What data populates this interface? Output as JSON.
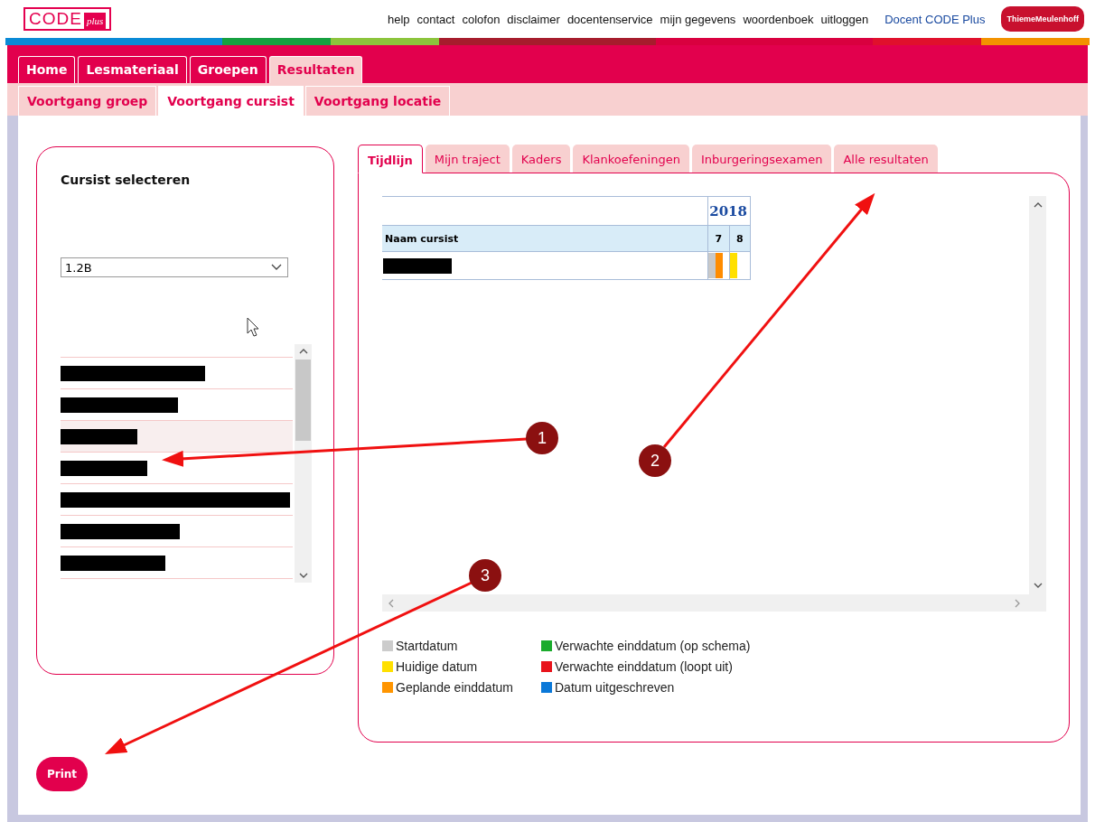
{
  "header": {
    "logo": {
      "main": "CODE",
      "sub": "plus"
    },
    "links": [
      "help",
      "contact",
      "colofon",
      "disclaimer",
      "docentenservice",
      "mijn gegevens",
      "woordenboek",
      "uitloggen"
    ],
    "user": "Docent CODE Plus",
    "publisher_logo": "ThiemeMeulenhoff"
  },
  "main_nav": [
    {
      "label": "Home",
      "selected": false
    },
    {
      "label": "Lesmateriaal",
      "selected": false
    },
    {
      "label": "Groepen",
      "selected": false
    },
    {
      "label": "Resultaten",
      "selected": true
    }
  ],
  "sub_nav": [
    {
      "label": "Voortgang groep",
      "selected": false
    },
    {
      "label": "Voortgang cursist",
      "selected": true
    },
    {
      "label": "Voortgang locatie",
      "selected": false
    }
  ],
  "student_panel": {
    "title": "Cursist selecteren",
    "group_select": {
      "value": "1.2B"
    },
    "students": [
      {
        "selected": false
      },
      {
        "selected": false
      },
      {
        "selected": true
      },
      {
        "selected": false
      },
      {
        "selected": false
      },
      {
        "selected": false
      },
      {
        "selected": false
      }
    ]
  },
  "result_tabs": [
    {
      "label": "Tijdlijn",
      "selected": true
    },
    {
      "label": "Mijn traject",
      "selected": false
    },
    {
      "label": "Kaders",
      "selected": false
    },
    {
      "label": "Klankoefeningen",
      "selected": false
    },
    {
      "label": "Inburgeringsexamen",
      "selected": false
    },
    {
      "label": "Alle resultaten",
      "selected": false
    }
  ],
  "timeline": {
    "year": "2018",
    "name_header": "Naam cursist",
    "months": [
      "7",
      "8"
    ],
    "rows": [
      {
        "cells": [
          {
            "markers": [
              {
                "color": "#c8c8c8"
              },
              {
                "color": "#ff8c00"
              }
            ]
          },
          {
            "markers": [
              {
                "color": "#ffe000"
              }
            ]
          }
        ]
      }
    ]
  },
  "legend": [
    {
      "label": "Startdatum",
      "color": "#cccccc"
    },
    {
      "label": "Verwachte einddatum (op schema)",
      "color": "#1aab2c"
    },
    {
      "label": "Huidige datum",
      "color": "#ffe000"
    },
    {
      "label": "Verwachte einddatum (loopt uit)",
      "color": "#e8141c"
    },
    {
      "label": "Geplande einddatum",
      "color": "#ff9500"
    },
    {
      "label": "Datum uitgeschreven",
      "color": "#0a78d8"
    }
  ],
  "print_button": "Print",
  "annotations": [
    "1",
    "2",
    "3"
  ]
}
